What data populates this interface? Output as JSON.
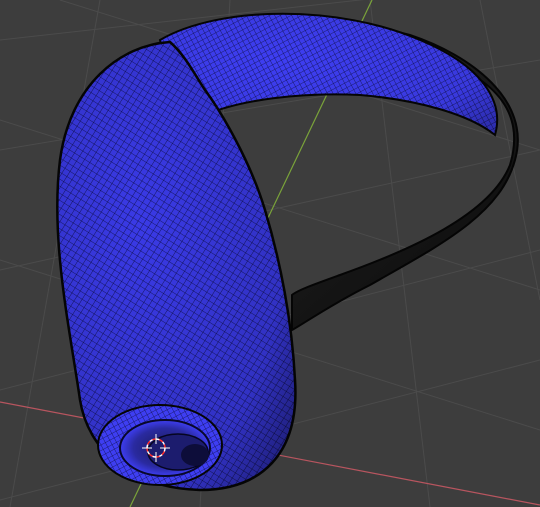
{
  "app": "3D viewport",
  "viewport": {
    "background": "#3d3d3d",
    "grid_color": "#4a4a4a",
    "axis_x_color": "#b8555f",
    "axis_y_color": "#7aa33a"
  },
  "mesh": {
    "object": "curved-horn-tube-mesh",
    "face_color": "#3e3ef2",
    "wire_color": "#111111",
    "shaded_tail_color": "#1b1b1b",
    "mode": "wireframe-over-solid"
  },
  "cursor": {
    "icon": "3d-cursor-icon",
    "ring_colors": [
      "#ff2d2d",
      "#ffffff"
    ]
  }
}
